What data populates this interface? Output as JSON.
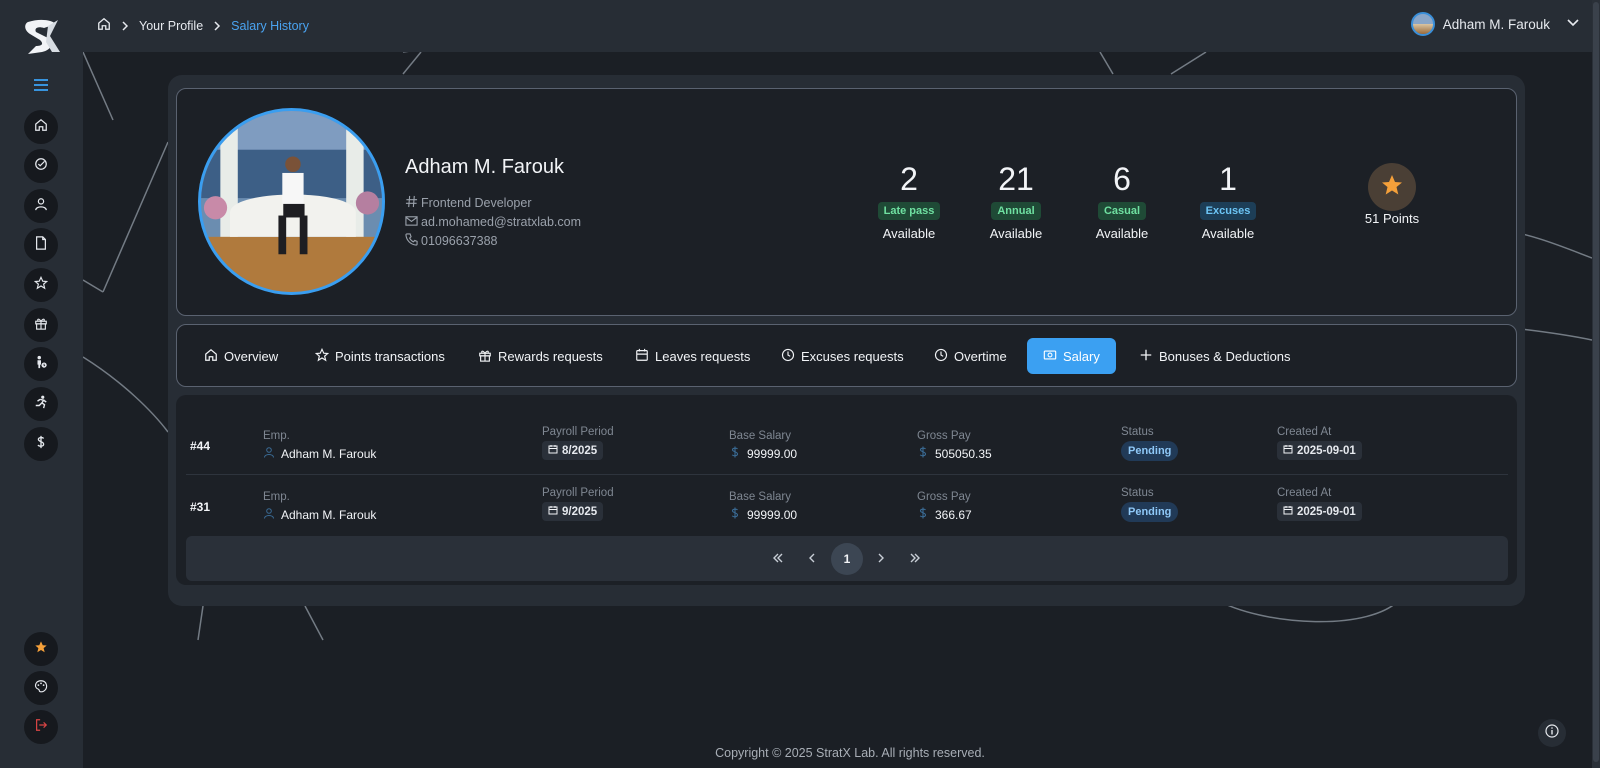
{
  "breadcrumb": {
    "items": [
      "Your Profile",
      "Salary History"
    ]
  },
  "user_menu": {
    "name": "Adham M. Farouk"
  },
  "sidebar": {
    "nav_icons": [
      "home-icon",
      "check-circle-icon",
      "user-icon",
      "file-icon",
      "star-icon",
      "gift-icon",
      "leave-icon",
      "running-icon",
      "dollar-icon"
    ],
    "bottom_icons": [
      "star-icon",
      "palette-icon",
      "logout-icon"
    ]
  },
  "profile": {
    "name": "Adham M. Farouk",
    "title": "Frontend Developer",
    "email": "ad.mohamed@stratxlab.com",
    "phone": "01096637388"
  },
  "stats": [
    {
      "value": "2",
      "badge": "Late pass",
      "available": "Available",
      "badge_color": "#6fe0a1"
    },
    {
      "value": "21",
      "badge": "Annual",
      "available": "Available",
      "badge_color": "#6fe0a1"
    },
    {
      "value": "6",
      "badge": "Casual",
      "available": "Available",
      "badge_color": "#6fe0a1"
    },
    {
      "value": "1",
      "badge": "Excuses",
      "available": "Available",
      "badge_color": "#6cc4f4"
    }
  ],
  "points": {
    "label": "51 Points"
  },
  "tabs": [
    {
      "label": "Overview",
      "icon": "home-icon"
    },
    {
      "label": "Points transactions",
      "icon": "star-icon"
    },
    {
      "label": "Rewards requests",
      "icon": "gift-icon"
    },
    {
      "label": "Leaves requests",
      "icon": "calendar-icon"
    },
    {
      "label": "Excuses requests",
      "icon": "clock-icon"
    },
    {
      "label": "Overtime",
      "icon": "clock-icon"
    },
    {
      "label": "Salary",
      "icon": "money-icon",
      "active": true
    },
    {
      "label": "Bonuses & Deductions",
      "icon": "plus-icon"
    }
  ],
  "table": {
    "labels": {
      "emp": "Emp.",
      "period": "Payroll Period",
      "base": "Base Salary",
      "gross": "Gross Pay",
      "status": "Status",
      "created": "Created At"
    },
    "rows": [
      {
        "id": "#44",
        "emp": "Adham M. Farouk",
        "period": "8/2025",
        "base": "99999.00",
        "gross": "505050.35",
        "status": "Pending",
        "created": "2025-09-01"
      },
      {
        "id": "#31",
        "emp": "Adham M. Farouk",
        "period": "9/2025",
        "base": "99999.00",
        "gross": "366.67",
        "status": "Pending",
        "created": "2025-09-01"
      }
    ]
  },
  "pagination": {
    "current": "1"
  },
  "footer": {
    "text": "Copyright © 2025 StratX Lab. All rights reserved."
  },
  "colors": {
    "accent": "#3ba0f2",
    "background": "#1b1f25",
    "panel": "#272d35"
  }
}
